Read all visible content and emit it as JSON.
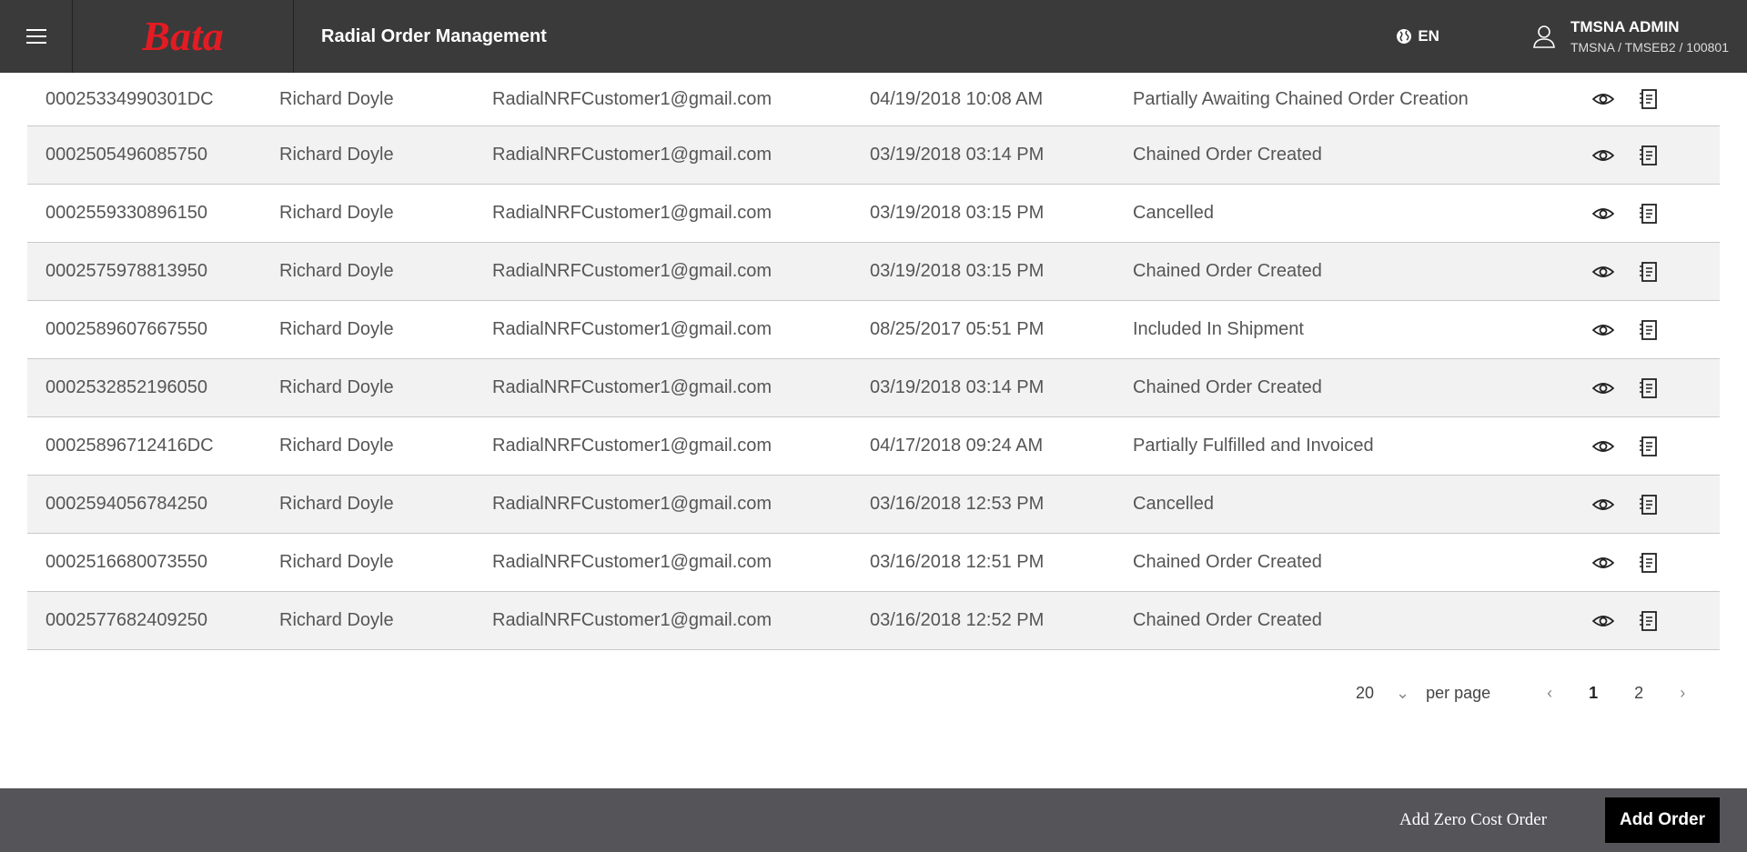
{
  "header": {
    "brand": "Bata",
    "title": "Radial Order Management",
    "language": "EN",
    "user_name": "TMSNA ADMIN",
    "user_context": "TMSNA / TMSEB2 / 100801",
    "brand_color": "#e31b23"
  },
  "orders": [
    {
      "id": "00025334990301DC",
      "customer": "Richard Doyle",
      "email": "RadialNRFCustomer1@gmail.com",
      "date": "04/19/2018 10:08 AM",
      "status": "Partially Awaiting Chained Order Creation"
    },
    {
      "id": "0002505496085750",
      "customer": "Richard Doyle",
      "email": "RadialNRFCustomer1@gmail.com",
      "date": "03/19/2018 03:14 PM",
      "status": "Chained Order Created"
    },
    {
      "id": "0002559330896150",
      "customer": "Richard Doyle",
      "email": "RadialNRFCustomer1@gmail.com",
      "date": "03/19/2018 03:15 PM",
      "status": "Cancelled"
    },
    {
      "id": "0002575978813950",
      "customer": "Richard Doyle",
      "email": "RadialNRFCustomer1@gmail.com",
      "date": "03/19/2018 03:15 PM",
      "status": "Chained Order Created"
    },
    {
      "id": "0002589607667550",
      "customer": "Richard Doyle",
      "email": "RadialNRFCustomer1@gmail.com",
      "date": "08/25/2017 05:51 PM",
      "status": "Included In Shipment"
    },
    {
      "id": "0002532852196050",
      "customer": "Richard Doyle",
      "email": "RadialNRFCustomer1@gmail.com",
      "date": "03/19/2018 03:14 PM",
      "status": "Chained Order Created"
    },
    {
      "id": "00025896712416DC",
      "customer": "Richard Doyle",
      "email": "RadialNRFCustomer1@gmail.com",
      "date": "04/17/2018 09:24 AM",
      "status": "Partially Fulfilled and Invoiced"
    },
    {
      "id": "0002594056784250",
      "customer": "Richard Doyle",
      "email": "RadialNRFCustomer1@gmail.com",
      "date": "03/16/2018 12:53 PM",
      "status": "Cancelled"
    },
    {
      "id": "0002516680073550",
      "customer": "Richard Doyle",
      "email": "RadialNRFCustomer1@gmail.com",
      "date": "03/16/2018 12:51 PM",
      "status": "Chained Order Created"
    },
    {
      "id": "0002577682409250",
      "customer": "Richard Doyle",
      "email": "RadialNRFCustomer1@gmail.com",
      "date": "03/16/2018 12:52 PM",
      "status": "Chained Order Created"
    }
  ],
  "row_icons": [
    "eye-icon",
    "invoice-icon"
  ],
  "pagination": {
    "per_page_value": "20",
    "per_page_label": "per page",
    "current_page": "1",
    "next_page": "2"
  },
  "footer": {
    "zero_cost_label": "Add Zero Cost Order",
    "add_order_label": "Add Order"
  }
}
